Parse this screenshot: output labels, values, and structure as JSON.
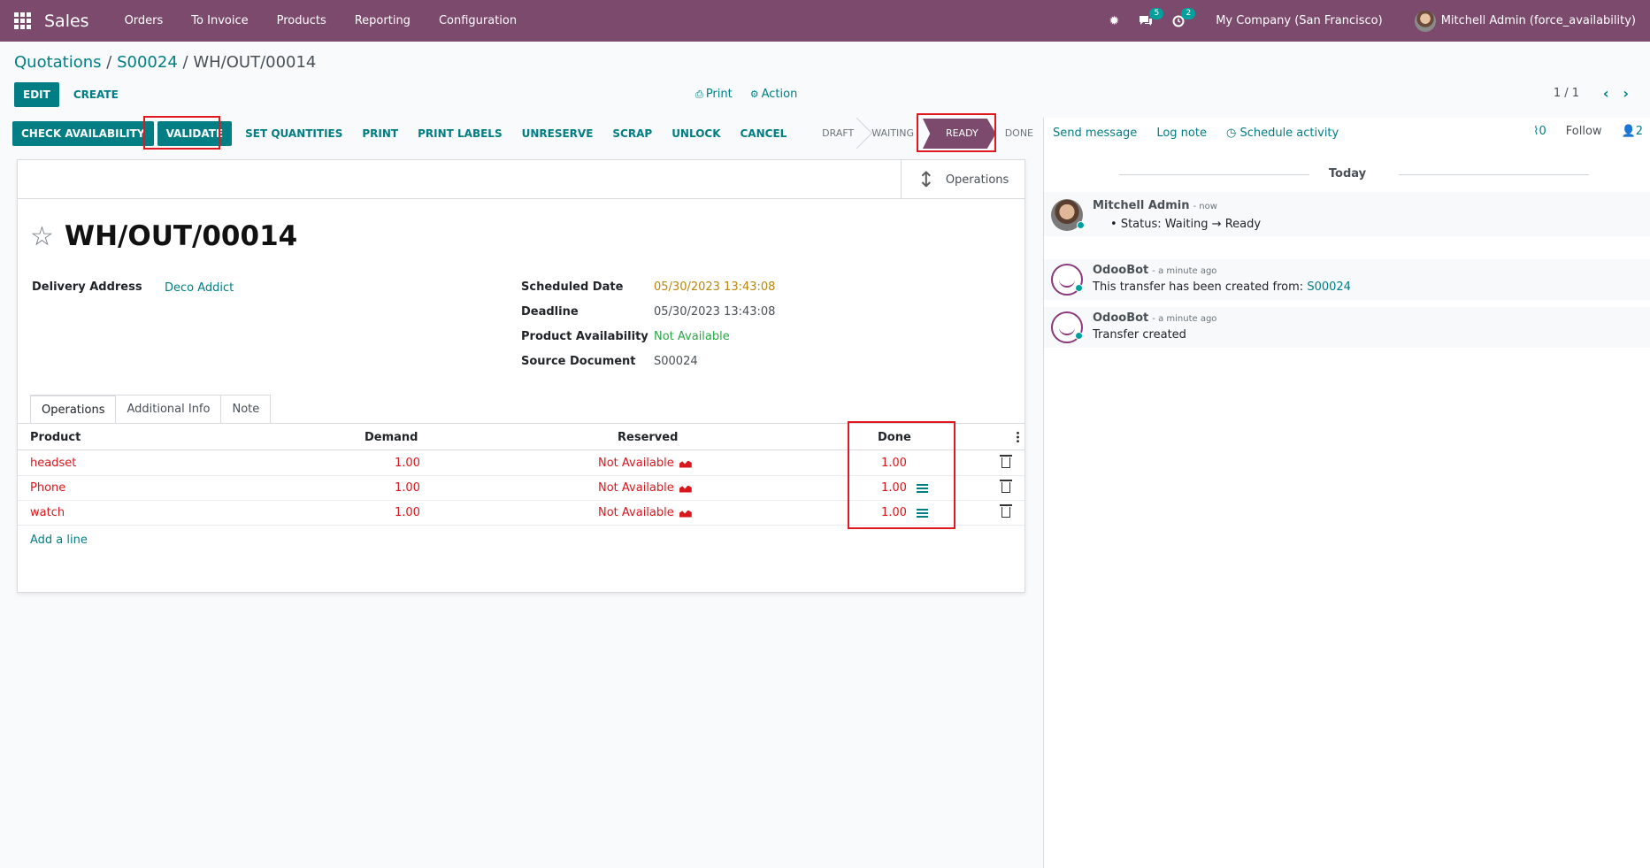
{
  "navbar": {
    "brand": "Sales",
    "menu": [
      "Orders",
      "To Invoice",
      "Products",
      "Reporting",
      "Configuration"
    ],
    "messages_count": "5",
    "activities_count": "2",
    "company": "My Company (San Francisco)",
    "user": "Mitchell Admin (force_availability)"
  },
  "breadcrumb": {
    "item1": "Quotations",
    "sep": "/",
    "item2": "S00024",
    "current": "WH/OUT/00014"
  },
  "control": {
    "edit": "EDIT",
    "create": "CREATE",
    "print": "Print",
    "action": "Action",
    "pager": "1 / 1"
  },
  "statusbar": {
    "buttons": [
      "CHECK AVAILABILITY",
      "VALIDATE",
      "SET QUANTITIES",
      "PRINT",
      "PRINT LABELS",
      "UNRESERVE",
      "SCRAP",
      "UNLOCK",
      "CANCEL"
    ],
    "states": [
      "DRAFT",
      "WAITING",
      "READY",
      "DONE"
    ],
    "current_state": "READY"
  },
  "form": {
    "smart_button": "Operations",
    "title": "WH/OUT/00014",
    "delivery_address_label": "Delivery Address",
    "delivery_address": "Deco Addict",
    "scheduled_date_label": "Scheduled Date",
    "scheduled_date": "05/30/2023 13:43:08",
    "deadline_label": "Deadline",
    "deadline": "05/30/2023 13:43:08",
    "availability_label": "Product Availability",
    "availability": "Not Available",
    "source_label": "Source Document",
    "source": "S00024",
    "tabs": [
      "Operations",
      "Additional Info",
      "Note"
    ],
    "columns": [
      "Product",
      "Demand",
      "Reserved",
      "Done"
    ],
    "rows": [
      {
        "product": "headset",
        "demand": "1.00",
        "reserved": "Not Available",
        "done": "1.00"
      },
      {
        "product": "Phone",
        "demand": "1.00",
        "reserved": "Not Available",
        "done": "1.00"
      },
      {
        "product": "watch",
        "demand": "1.00",
        "reserved": "Not Available",
        "done": "1.00"
      }
    ],
    "add_line": "Add a line"
  },
  "chatter": {
    "send_message": "Send message",
    "log_note": "Log note",
    "schedule_activity": "Schedule activity",
    "attachments": "0",
    "follow": "Follow",
    "followers": "2",
    "date_separator": "Today",
    "messages": [
      {
        "author": "Mitchell Admin",
        "when": "- now",
        "body": "Status: Waiting → Ready"
      },
      {
        "author": "OdooBot",
        "when": "- a minute ago",
        "body": "This transfer has been created from:",
        "link": "S00024"
      },
      {
        "author": "OdooBot",
        "when": "- a minute ago",
        "body": "Transfer created"
      }
    ]
  },
  "colors": {
    "navbar": "#7c4a6c",
    "primary": "#017e84",
    "danger": "#d9181e",
    "highlight": "#e0181f"
  }
}
